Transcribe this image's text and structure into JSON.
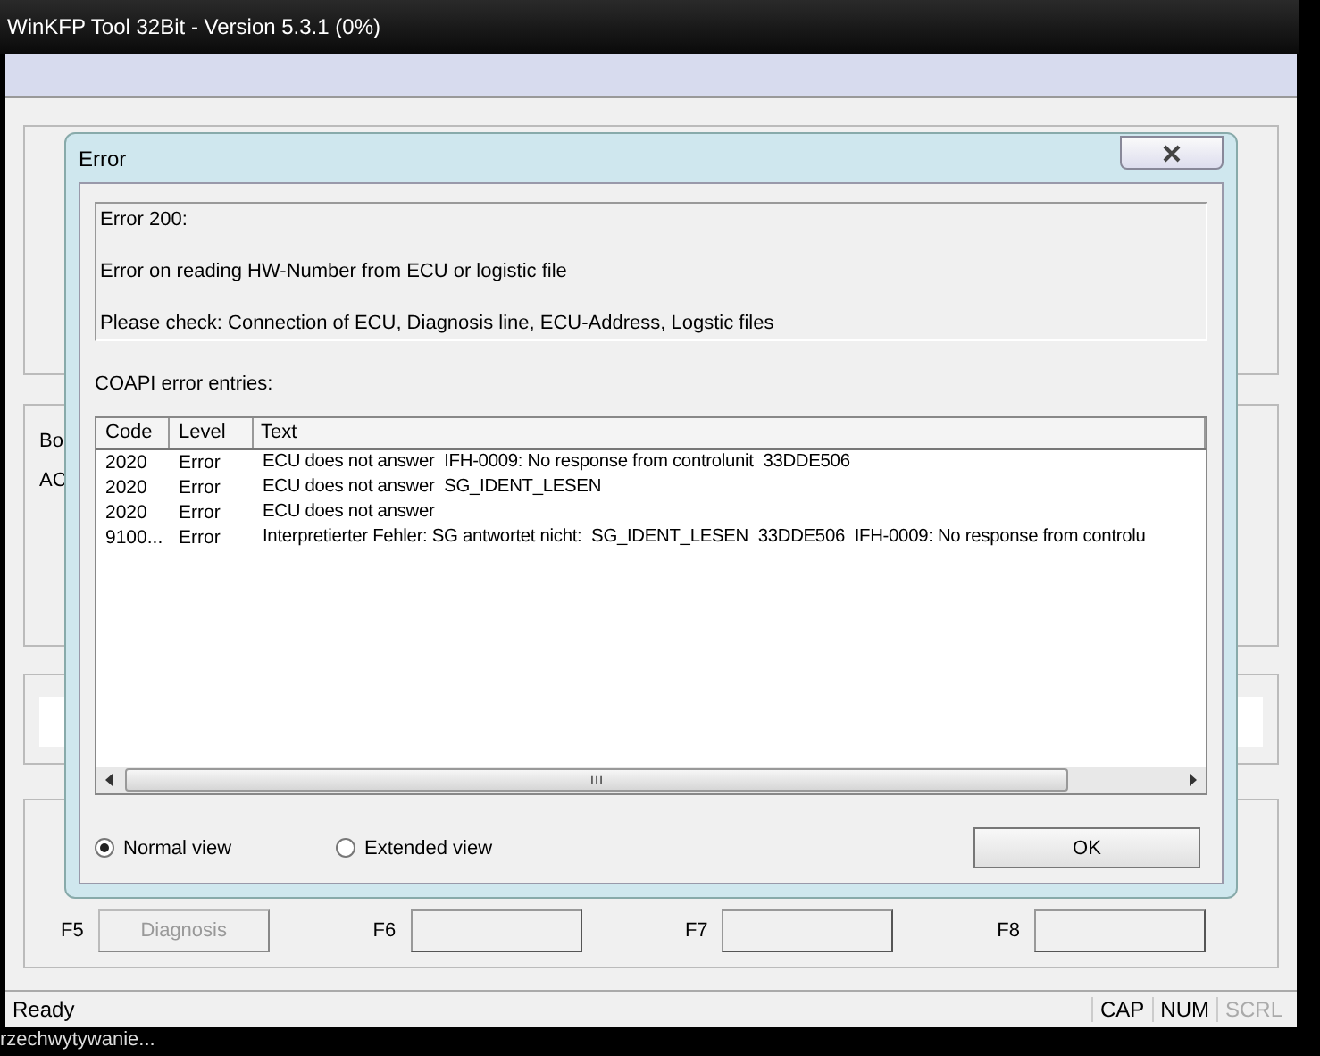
{
  "window": {
    "title": "WinKFP Tool 32Bit - Version 5.3.1 (0%)"
  },
  "background_labels": [
    {
      "text": "Bo"
    },
    {
      "text": "AC"
    }
  ],
  "function_keys": [
    {
      "key": "F5",
      "label": "Diagnosis",
      "disabled": true
    },
    {
      "key": "F6",
      "disabled": false
    },
    {
      "key": "F7",
      "disabled": false
    },
    {
      "key": "F8",
      "disabled": false
    }
  ],
  "status_bar": {
    "text": "Ready",
    "indicators": [
      {
        "label": "CAP",
        "on": true
      },
      {
        "label": "NUM",
        "on": true
      },
      {
        "label": "SCRL",
        "on": false
      }
    ]
  },
  "taskbar": {
    "text": "rzechwytywanie..."
  },
  "dialog": {
    "title": "Error",
    "message": [
      "Error 200:",
      "Error on reading HW-Number from ECU or logistic file",
      "Please check: Connection of ECU, Diagnosis line, ECU-Address, Logstic files"
    ],
    "entries_label": "COAPI error entries:",
    "table": {
      "columns": [
        "Code",
        "Level",
        "Text"
      ],
      "rows": [
        [
          "2020",
          "Error",
          "ECU does not answer  IFH-0009: No response from controlunit  33DDE506"
        ],
        [
          "2020",
          "Error",
          "ECU does not answer  SG_IDENT_LESEN"
        ],
        [
          "2020",
          "Error",
          "ECU does not answer"
        ],
        [
          "9100...",
          "Error",
          "Interpretierter Fehler: SG antwortet nicht:  SG_IDENT_LESEN  33DDE506  IFH-0009: No response from controlu"
        ]
      ]
    },
    "views": [
      {
        "label": "Normal view",
        "selected": true
      },
      {
        "label": "Extended view",
        "selected": false
      }
    ],
    "ok_button": "OK"
  }
}
